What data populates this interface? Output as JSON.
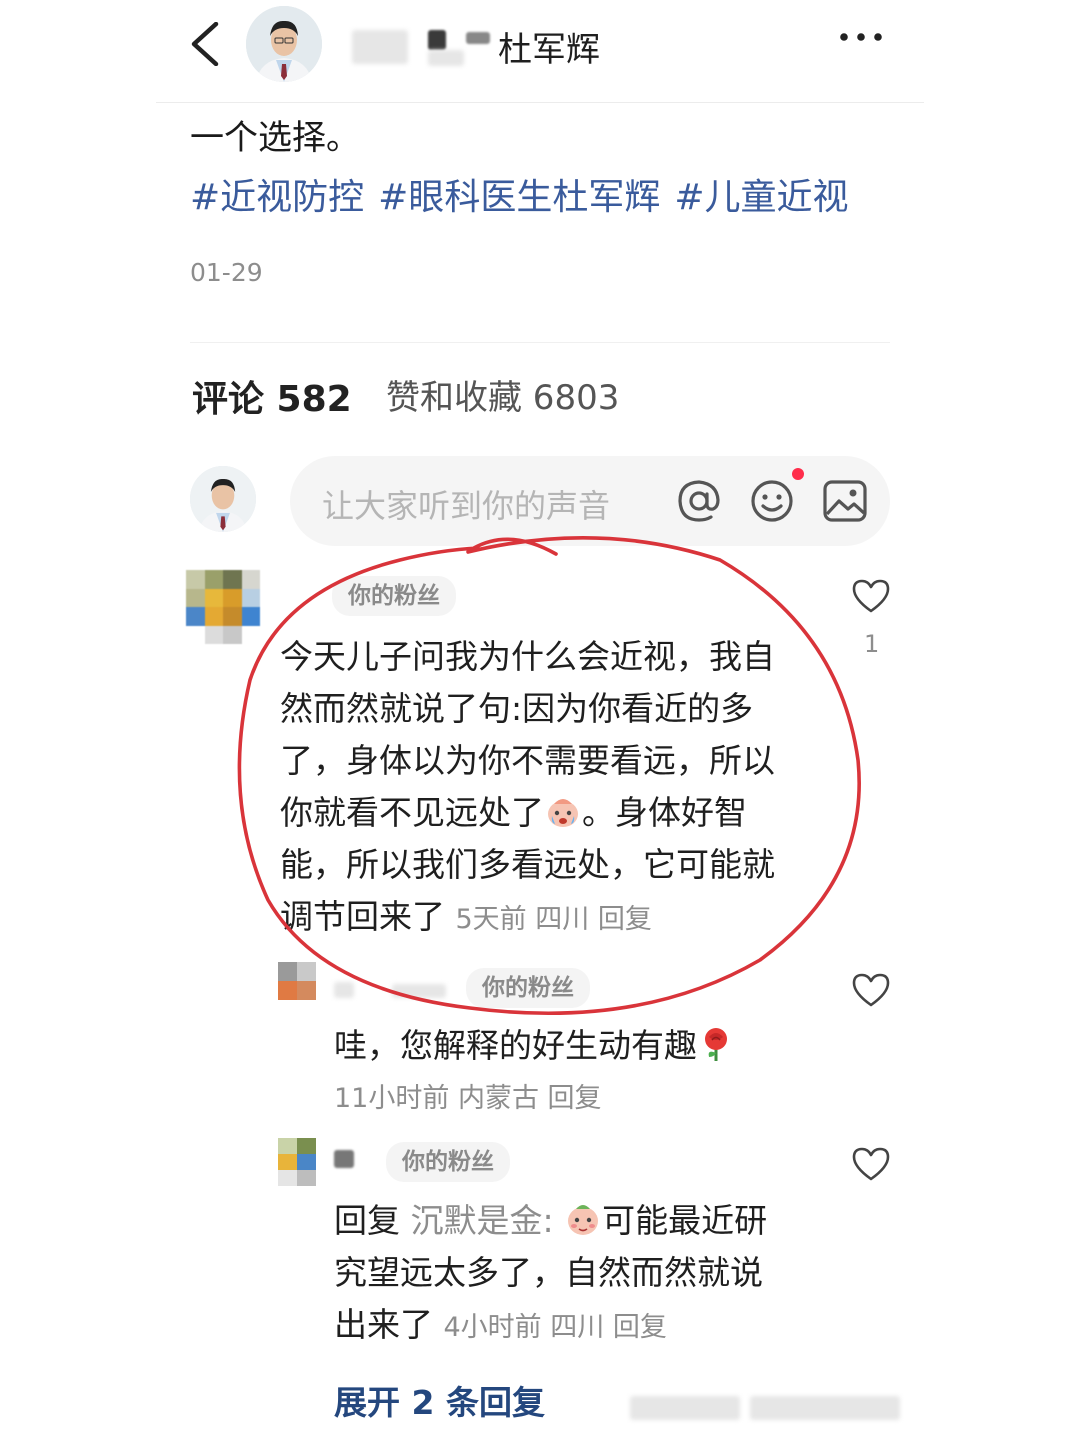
{
  "header": {
    "author_name": "杜军辉"
  },
  "post": {
    "text_tail": "一个选择。",
    "tags": [
      "#近视防控",
      "#眼科医生杜军辉",
      "#儿童近视"
    ],
    "date": "01-29"
  },
  "stats": {
    "comments_label": "评论 582",
    "likes_label": "赞和收藏 6803"
  },
  "comment_input": {
    "placeholder": "让大家听到你的声音"
  },
  "comments": [
    {
      "badge": "你的粉丝",
      "lines": [
        "今天儿子问我为什么会近视，我自",
        "然而然就说了句:因为你看近的多",
        "了，身体以为你不需要看远，所以",
        "你就看不见远处了"
      ],
      "line4_after_emoji": "。身体好智",
      "lines_end": [
        "能，所以我们多看远处，它可能就"
      ],
      "last_line": "调节回来了",
      "meta": "5天前  四川 回复",
      "like_count": "1"
    },
    {
      "badge": "你的粉丝",
      "text": "哇，您解释的好生动有趣",
      "meta": "11小时前  内蒙古 回复"
    },
    {
      "badge": "你的粉丝",
      "reply_prefix": "回复",
      "reply_to": "沉默是金:",
      "line1_after_emoji": "可能最近研",
      "line2": "究望远太多了，自然而然就说",
      "line3": "出来了",
      "meta": "4小时前  四川 回复"
    }
  ],
  "expand_label": "展开 2 条回复",
  "colors": {
    "tag_blue": "#3a5b9c",
    "expand_blue": "#24477e",
    "annotation_red": "#d9343a",
    "notification_dot": "#ff2d4b"
  },
  "icons": [
    "back-icon",
    "more-icon",
    "at-icon",
    "emoji-icon",
    "image-icon",
    "heart-icon"
  ]
}
